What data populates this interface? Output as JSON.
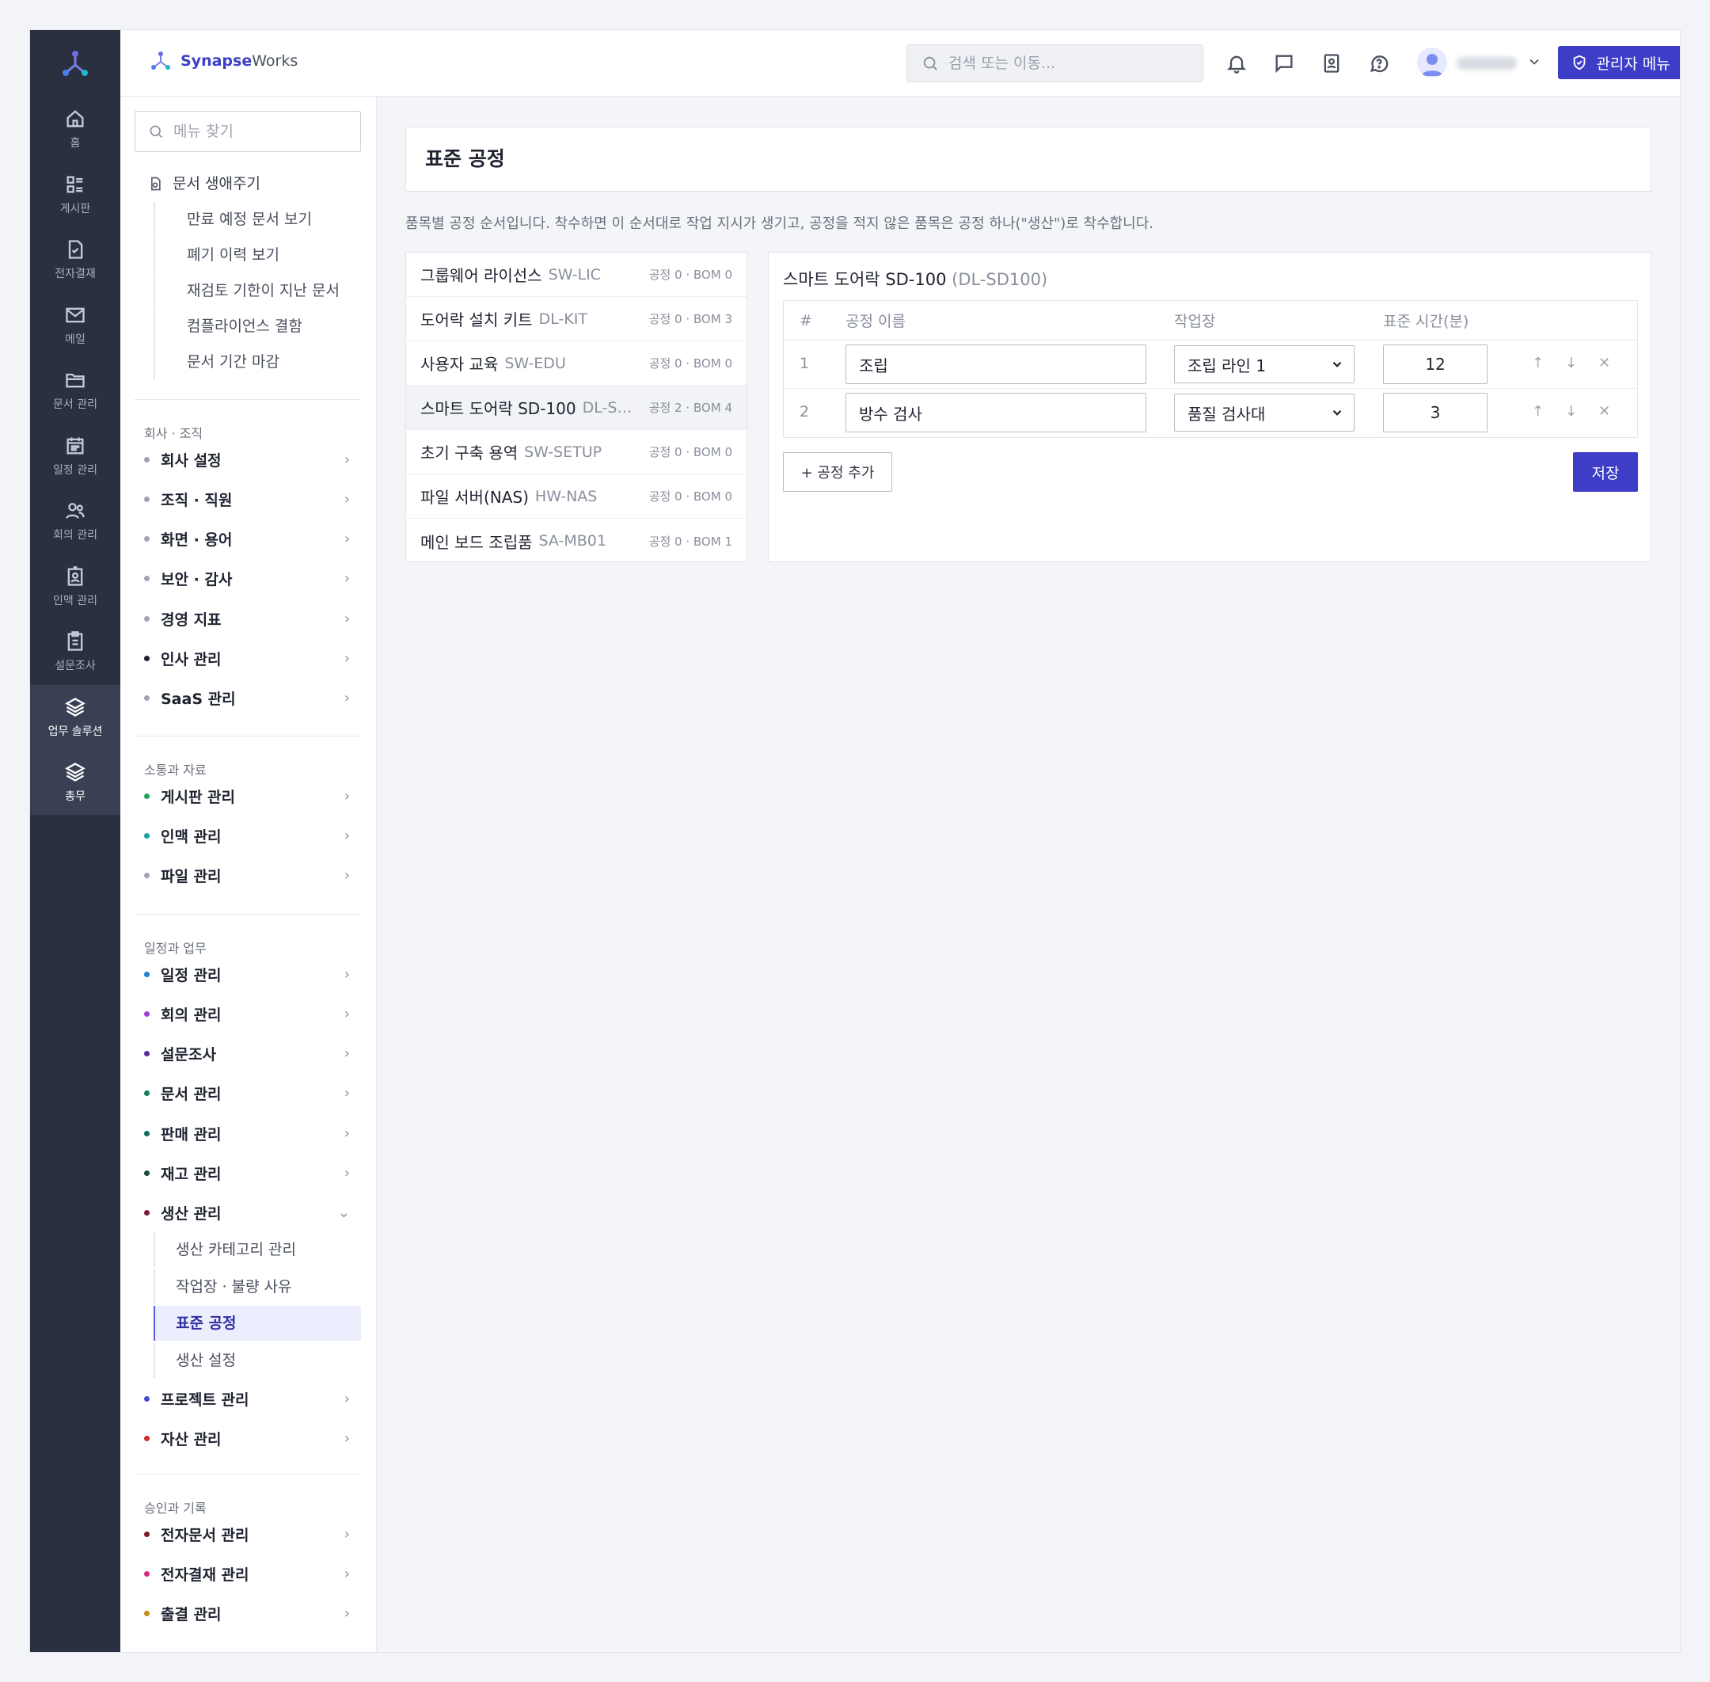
{
  "brand": {
    "part1": "Synapse",
    "part2": "Works"
  },
  "header": {
    "search_placeholder": "검색 또는 이동...",
    "admin_label": "관리자 메뉴"
  },
  "rail": {
    "items": [
      {
        "label": "홈",
        "icon": "home-icon"
      },
      {
        "label": "게시판",
        "icon": "board-icon"
      },
      {
        "label": "전자결재",
        "icon": "approval-icon"
      },
      {
        "label": "메일",
        "icon": "mail-icon"
      },
      {
        "label": "문서 관리",
        "icon": "folder-icon"
      },
      {
        "label": "일정 관리",
        "icon": "calendar-icon"
      },
      {
        "label": "회의 관리",
        "icon": "people-icon"
      },
      {
        "label": "인맥 관리",
        "icon": "contact-icon"
      },
      {
        "label": "설문조사",
        "icon": "survey-icon"
      },
      {
        "label": "업무 솔루션",
        "icon": "layers-icon"
      },
      {
        "label": "총무",
        "icon": "layers-icon"
      }
    ]
  },
  "sidemenu": {
    "search_placeholder": "메뉴 찾기",
    "lifecycle": {
      "label": "문서 생애주기",
      "subs": [
        "만료 예정 문서 보기",
        "폐기 이력 보기",
        "재검토 기한이 지난 문서",
        "컴플라이언스 결함",
        "문서 기간 마감"
      ]
    },
    "groups": [
      {
        "label": "회사 · 조직",
        "items": [
          {
            "label": "회사 설정",
            "color": "#a0a4b0"
          },
          {
            "label": "조직 · 직원",
            "color": "#a0a4b0"
          },
          {
            "label": "화면 · 용어",
            "color": "#a0a4b0"
          },
          {
            "label": "보안 · 감사",
            "color": "#a0a4b0"
          },
          {
            "label": "경영 지표",
            "color": "#a0a4b0"
          },
          {
            "label": "인사 관리",
            "color": "#1f2330"
          },
          {
            "label": "SaaS 관리",
            "color": "#a0a4b0"
          }
        ]
      },
      {
        "label": "소통과 자료",
        "items": [
          {
            "label": "게시판 관리",
            "color": "#1fa35a"
          },
          {
            "label": "인맥 관리",
            "color": "#12a39a"
          },
          {
            "label": "파일 관리",
            "color": "#a0a4b0"
          }
        ]
      },
      {
        "label": "일정과 업무",
        "items": [
          {
            "label": "일정 관리",
            "color": "#1e7fd6"
          },
          {
            "label": "회의 관리",
            "color": "#a63fd6"
          },
          {
            "label": "설문조사",
            "color": "#5a2a9a"
          },
          {
            "label": "문서 관리",
            "color": "#12805a"
          },
          {
            "label": "판매 관리",
            "color": "#0f6a5a"
          },
          {
            "label": "재고 관리",
            "color": "#184a40"
          },
          {
            "label": "생산 관리",
            "color": "#7a1a3a"
          }
        ]
      },
      {
        "label": "승인과 기록",
        "items": [
          {
            "label": "전자문서 관리",
            "color": "#7a1a2a"
          },
          {
            "label": "전자결재 관리",
            "color": "#d62a7a"
          },
          {
            "label": "출결 관리",
            "color": "#c88a1a"
          }
        ]
      }
    ],
    "production_subs": [
      "생산 카테고리 관리",
      "작업장 · 불량 사유",
      "표준 공정",
      "생산 설정"
    ],
    "after_production": [
      {
        "label": "프로젝트 관리",
        "color": "#4a4ad6"
      },
      {
        "label": "자산 관리",
        "color": "#d62a2a"
      }
    ]
  },
  "main": {
    "title": "표준 공정",
    "description": "품목별 공정 순서입니다. 착수하면 이 순서대로 작업 지시가 생기고, 공정을 적지 않은 품목은 공정 하나(\"생산\")로 착수합니다.",
    "products": [
      {
        "name": "그룹웨어 라이선스",
        "code": "SW-LIC",
        "meta": "공정 0 · BOM 0"
      },
      {
        "name": "도어락 설치 키트",
        "code": "DL-KIT",
        "meta": "공정 0 · BOM 3"
      },
      {
        "name": "사용자 교육",
        "code": "SW-EDU",
        "meta": "공정 0 · BOM 0"
      },
      {
        "name": "스마트 도어락 SD-100",
        "code": "DL-SD100",
        "meta": "공정 2 · BOM 4"
      },
      {
        "name": "초기 구축 용역",
        "code": "SW-SETUP",
        "meta": "공정 0 · BOM 0"
      },
      {
        "name": "파일 서버(NAS)",
        "code": "HW-NAS",
        "meta": "공정 0 · BOM 0"
      },
      {
        "name": "메인 보드 조립품",
        "code": "SA-MB01",
        "meta": "공정 0 · BOM 1"
      }
    ],
    "detail": {
      "name": "스마트 도어락 SD-100",
      "code": "(DL-SD100)",
      "columns": {
        "num": "#",
        "name": "공정 이름",
        "workplace": "작업장",
        "time": "표준 시간(분)"
      },
      "rows": [
        {
          "num": "1",
          "name": "조립",
          "workplace": "조립 라인 1",
          "time": "12"
        },
        {
          "num": "2",
          "name": "방수 검사",
          "workplace": "품질 검사대",
          "time": "3"
        }
      ],
      "add_label": "+ 공정 추가",
      "save_label": "저장"
    }
  }
}
